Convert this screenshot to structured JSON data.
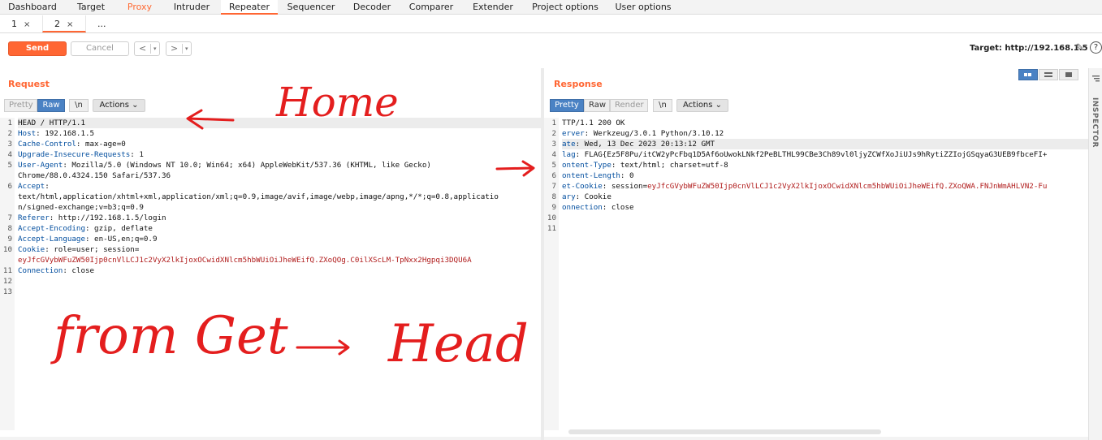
{
  "top_tabs": [
    {
      "label": "Dashboard"
    },
    {
      "label": "Target"
    },
    {
      "label": "Proxy"
    },
    {
      "label": "Intruder"
    },
    {
      "label": "Repeater"
    },
    {
      "label": "Sequencer"
    },
    {
      "label": "Decoder"
    },
    {
      "label": "Comparer"
    },
    {
      "label": "Extender"
    },
    {
      "label": "Project options"
    },
    {
      "label": "User options"
    }
  ],
  "sub_tabs": [
    {
      "label": "1",
      "close": "×"
    },
    {
      "label": "2",
      "close": "×"
    },
    {
      "label": "..."
    }
  ],
  "toolbar": {
    "send_label": "Send",
    "cancel_label": "Cancel",
    "back_arrow": "<",
    "forward_arrow": ">",
    "dropdown": "▾",
    "target_text": "Target: http://192.168.1.5",
    "edit_icon": "✎",
    "help_icon": "?"
  },
  "request": {
    "title": "Request",
    "views": {
      "pretty": "Pretty",
      "raw": "Raw",
      "newline": "\\n",
      "actions": "Actions ⌄"
    },
    "line_numbers": [
      "1",
      "2",
      "3",
      "4",
      "5",
      "",
      "6",
      "",
      "",
      "7",
      "8",
      "9",
      "10",
      "",
      "11",
      "12",
      "13"
    ],
    "lines": [
      {
        "key": "",
        "value": "HEAD / HTTP/1.1"
      },
      {
        "key": "Host",
        "value": ": 192.168.1.5"
      },
      {
        "key": "Cache-Control",
        "value": ": max-age=0"
      },
      {
        "key": "Upgrade-Insecure-Requests",
        "value": ": 1"
      },
      {
        "key": "User-Agent",
        "value": ": Mozilla/5.0 (Windows NT 10.0; Win64; x64) AppleWebKit/537.36 (KHTML, like Gecko)"
      },
      {
        "key": "",
        "value": "Chrome/88.0.4324.150 Safari/537.36"
      },
      {
        "key": "Accept",
        "value": ":"
      },
      {
        "key": "",
        "value": "text/html,application/xhtml+xml,application/xml;q=0.9,image/avif,image/webp,image/apng,*/*;q=0.8,applicatio"
      },
      {
        "key": "",
        "value": "n/signed-exchange;v=b3;q=0.9"
      },
      {
        "key": "Referer",
        "value": ": http://192.168.1.5/login"
      },
      {
        "key": "Accept-Encoding",
        "value": ": gzip, deflate"
      },
      {
        "key": "Accept-Language",
        "value": ": en-US,en;q=0.9"
      },
      {
        "key": "Cookie",
        "value": ": role=user; session="
      },
      {
        "key": "",
        "cookie": "eyJfcGVybWFuZW50Ijp0cnVlLCJ1c2VyX2lkIjoxOCwidXNlcm5hbWUiOiJheWEifQ.ZXoQOg.C0ilXScLM-TpNxx2Hgpqi3DQU6A"
      },
      {
        "key": "Connection",
        "value": ": close"
      },
      {
        "key": "",
        "value": ""
      },
      {
        "key": "",
        "value": ""
      }
    ]
  },
  "response": {
    "title": "Response",
    "views": {
      "pretty": "Pretty",
      "raw": "Raw",
      "render": "Render",
      "newline": "\\n",
      "actions": "Actions ⌄"
    },
    "line_numbers": [
      "1",
      "2",
      "3",
      "4",
      "5",
      "6",
      "7",
      "8",
      "9",
      "10",
      "11"
    ],
    "lines": [
      {
        "key": "",
        "value": "TTP/1.1 200 OK"
      },
      {
        "key": "erver",
        "value": ": Werkzeug/3.0.1 Python/3.10.12"
      },
      {
        "key": "ate",
        "value": ": Wed, 13 Dec 2023 20:13:12 GMT"
      },
      {
        "key": "lag",
        "value": ": FLAG{Ez5F8Pu/itCW2yPcFbq1D5Af6oUwokLNkf2PeBLTHL99CBe3Ch89vl0ljyZCWfXoJiUJs9hRytiZZIojGSqyaG3UEB9fbceFI+"
      },
      {
        "key": "ontent-Type",
        "value": ": text/html; charset=utf-8"
      },
      {
        "key": "ontent-Length",
        "value": ": 0"
      },
      {
        "key": "et-Cookie",
        "value": ": session=",
        "cookie": "eyJfcGVybWFuZW50Ijp0cnVlLCJ1c2VyX2lkIjoxOCwidXNlcm5hbWUiOiJheWEifQ.ZXoQWA.FNJnWmAHLVN2-Fu"
      },
      {
        "key": "ary",
        "value": ": Cookie"
      },
      {
        "key": "onnection",
        "value": ": close"
      },
      {
        "key": "",
        "value": ""
      },
      {
        "key": "",
        "value": ""
      }
    ]
  },
  "inspector_label": "INSPECTOR",
  "annotations": {
    "home": "Home",
    "from_get": "from Get",
    "head": "Head"
  },
  "colors": {
    "accent": "#ff6633",
    "annotation": "#e41e1e",
    "header_key": "#004d9e",
    "cookie_value": "#b01b1b"
  }
}
